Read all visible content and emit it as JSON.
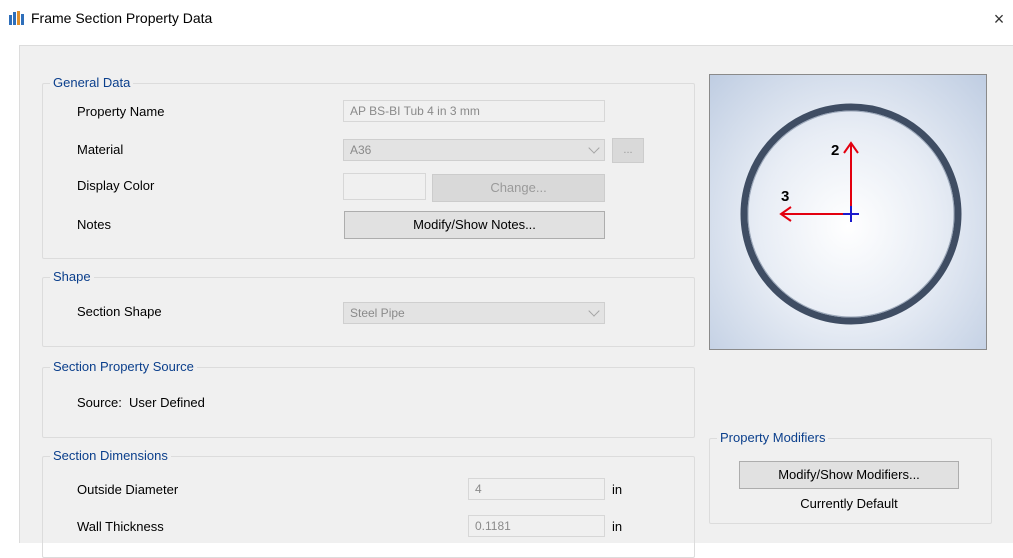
{
  "window": {
    "title": "Frame Section Property Data",
    "close_glyph": "×"
  },
  "general_data": {
    "group_label": "General Data",
    "property_name_label": "Property Name",
    "property_name_value": "AP BS-BI Tub 4 in 3 mm",
    "material_label": "Material",
    "material_value": "A36",
    "material_browse_label": "...",
    "display_color_label": "Display Color",
    "change_button_label": "Change...",
    "notes_label": "Notes",
    "notes_button_label": "Modify/Show Notes..."
  },
  "shape": {
    "group_label": "Shape",
    "section_shape_label": "Section Shape",
    "section_shape_value": "Steel Pipe"
  },
  "source": {
    "group_label": "Section Property Source",
    "source_text": "Source:  User Defined"
  },
  "dimensions": {
    "group_label": "Section Dimensions",
    "rows": [
      {
        "label": "Outside Diameter",
        "value": "4",
        "unit": "in"
      },
      {
        "label": "Wall Thickness",
        "value": "0.1181",
        "unit": "in"
      }
    ]
  },
  "preview": {
    "axis_2_label": "2",
    "axis_3_label": "3",
    "colors": {
      "pipe_ring": "#3f4d63",
      "axis_arrow": "#e3000f",
      "centroid": "#1a1acc"
    }
  },
  "modifiers": {
    "group_label": "Property Modifiers",
    "button_label": "Modify/Show Modifiers...",
    "status_text": "Currently Default"
  }
}
